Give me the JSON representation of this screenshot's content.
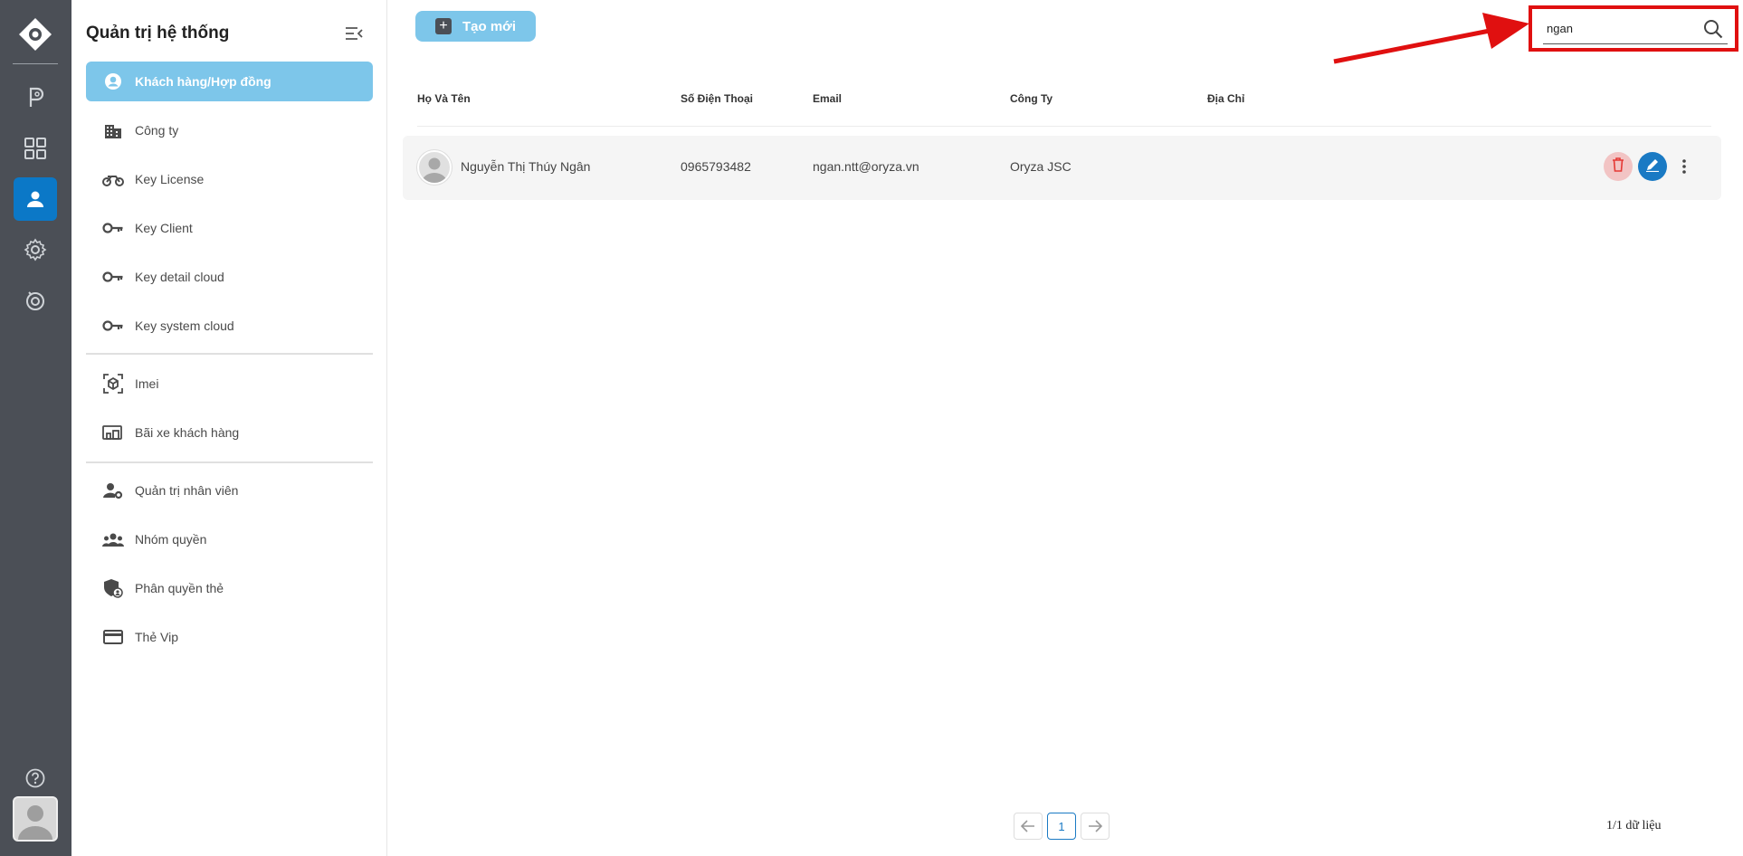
{
  "sidebar": {
    "title": "Quản trị hệ thống",
    "items": [
      {
        "label": "Khách hàng/Hợp đồng",
        "icon": "account-circle-icon",
        "active": true
      },
      {
        "label": "Công ty",
        "icon": "building-icon"
      },
      {
        "label": "Key License",
        "icon": "motorbike-icon"
      },
      {
        "label": "Key Client",
        "icon": "key-icon"
      },
      {
        "label": "Key detail cloud",
        "icon": "key-icon"
      },
      {
        "label": "Key system cloud",
        "icon": "key-icon"
      },
      {
        "label": "Imei",
        "icon": "cube-scan-icon"
      },
      {
        "label": "Bãi xe khách hàng",
        "icon": "devices-icon"
      },
      {
        "label": "Quản trị nhân viên",
        "icon": "user-gear-icon"
      },
      {
        "label": "Nhóm quyền",
        "icon": "group-icon"
      },
      {
        "label": "Phân quyền thẻ",
        "icon": "shield-user-icon"
      },
      {
        "label": "Thẻ Vip",
        "icon": "credit-card-icon"
      }
    ]
  },
  "toolbar": {
    "create_label": "Tạo mới"
  },
  "search": {
    "value": "ngan"
  },
  "table": {
    "headers": [
      "Họ Và Tên",
      "Số Điện Thoại",
      "Email",
      "Công Ty",
      "Địa Chỉ"
    ],
    "rows": [
      {
        "name": "Nguyễn Thị Thúy Ngân",
        "phone": "0965793482",
        "email": "ngan.ntt@oryza.vn",
        "company": "Oryza JSC",
        "address": ""
      }
    ]
  },
  "pagination": {
    "current_page": "1",
    "summary": "1/1 dữ liệu"
  },
  "colors": {
    "rail": "#4b4f56",
    "accent": "#7dc6ea",
    "primary": "#0b78c7",
    "highlight": "#e01010"
  }
}
